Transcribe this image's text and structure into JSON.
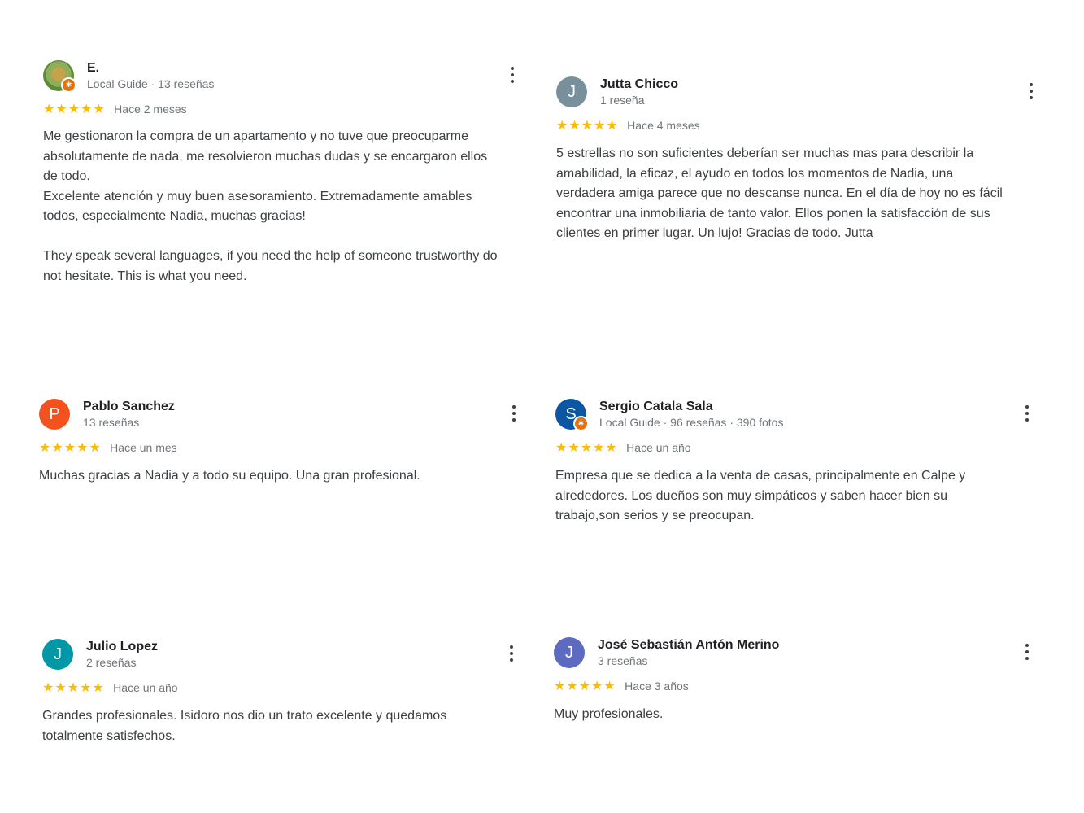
{
  "reviews": [
    {
      "name": "E.",
      "meta": "Local Guide · 13 reseñas",
      "stars": "★★★★★",
      "date": "Hace 2 meses",
      "text": "Me gestionaron la compra de un apartamento y no tuve que preocuparme\nabsolutamente de nada, me resolvieron muchas dudas y se encargaron ellos\nde todo.\nExcelente atención y muy buen asesoramiento. Extremadamente amables\ntodos, especialmente Nadia, muchas gracias!\n\nThey speak several languages, if you need the help of someone trustworthy do\nnot hesitate. This is what you need."
    },
    {
      "name": "Jutta Chicco",
      "meta": "1 reseña",
      "avatar_letter": "J",
      "avatar_color": "#78909c",
      "stars": "★★★★★",
      "date": "Hace 4 meses",
      "text": "5 estrellas no son suficientes deberían ser muchas mas para describir la\namabilidad, la eficaz, el ayudo en todos los momentos de Nadia, una\nverdadera amiga parece que no descanse nunca. En el día de hoy no es fácil\nencontrar una inmobiliaria de tanto valor. Ellos ponen la satisfacción de sus\nclientes en primer lugar. Un lujo! Gracias de todo. Jutta"
    },
    {
      "name": "Pablo Sanchez",
      "meta": "13 reseñas",
      "avatar_letter": "P",
      "avatar_color": "#f4511e",
      "stars": "★★★★★",
      "date": "Hace un mes",
      "text": "Muchas gracias a Nadia y a todo su equipo. Una gran profesional."
    },
    {
      "name": "Sergio Catala Sala",
      "meta": "Local Guide · 96 reseñas · 390 fotos",
      "avatar_letter": "S",
      "avatar_color": "#0b57a4",
      "stars": "★★★★★",
      "date": "Hace un año",
      "text": "Empresa que se dedica a la venta de casas, principalmente en Calpe y\nalrededores. Los dueños son muy simpáticos y saben hacer bien su\ntrabajo,son serios y se preocupan."
    },
    {
      "name": "Julio Lopez",
      "meta": "2 reseñas",
      "avatar_letter": "J",
      "avatar_color": "#0097a7",
      "stars": "★★★★★",
      "date": "Hace un año",
      "text": "Grandes profesionales. Isidoro nos dio un trato excelente y quedamos\ntotalmente satisfechos."
    },
    {
      "name": "José Sebastián Antón Merino",
      "meta": "3 reseñas",
      "avatar_letter": "J",
      "avatar_color": "#5c6bc0",
      "stars": "★★★★★",
      "date": "Hace 3 años",
      "text": "Muy profesionales."
    }
  ],
  "icons": {
    "more": "more-vert-icon",
    "local_guide_badge": "local-guide-badge-icon"
  },
  "colors": {
    "star": "#fbbc04",
    "guide_badge": "#e8710a",
    "meta_text": "#70757a"
  }
}
